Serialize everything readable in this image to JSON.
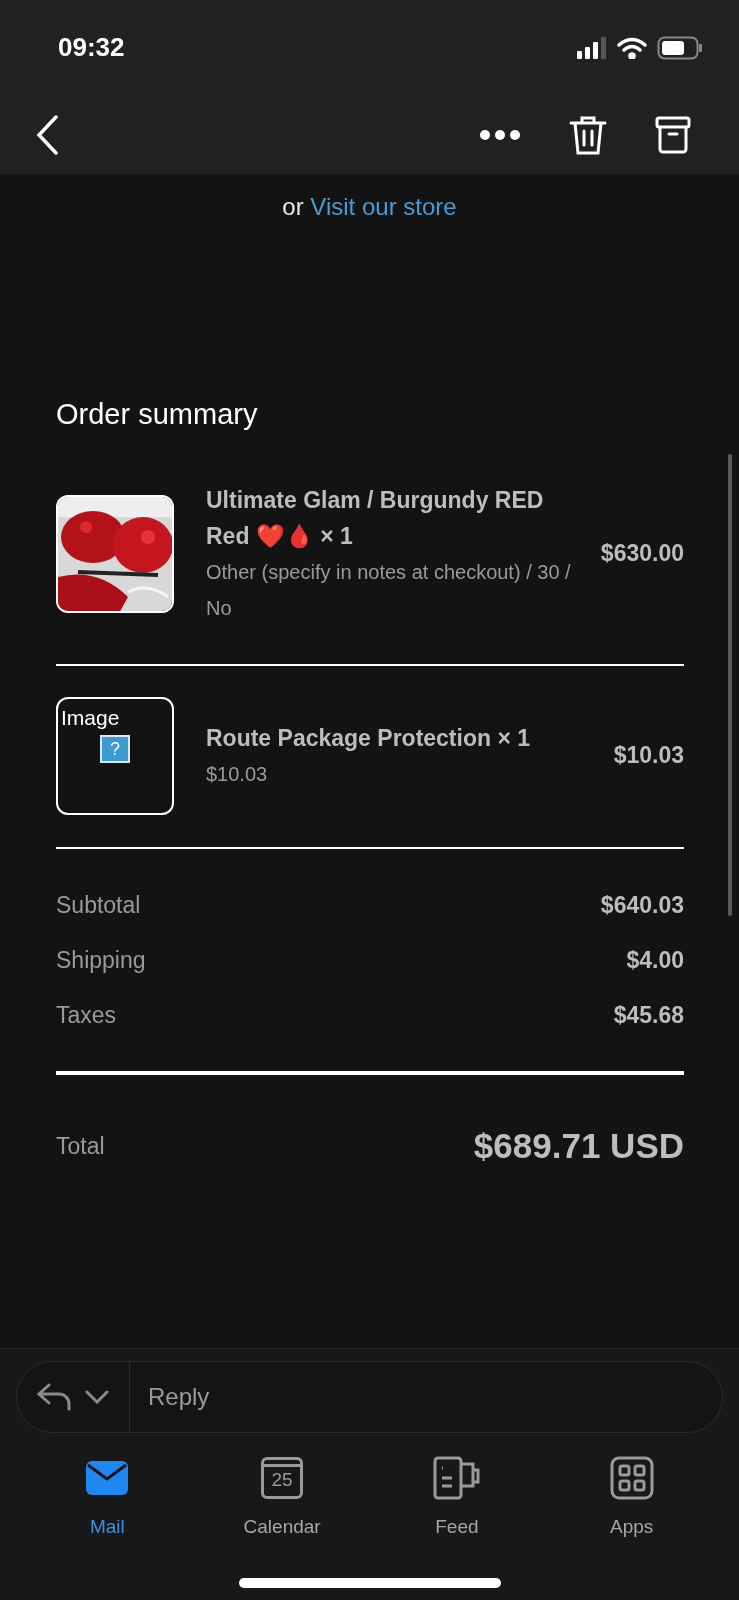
{
  "status_bar": {
    "time": "09:32"
  },
  "header_link": {
    "prefix": "or",
    "link": "Visit our store"
  },
  "order_summary": {
    "title": "Order summary",
    "items": [
      {
        "name": "Ultimate Glam / Burgundy RED Red ❤️🩸 × 1",
        "details": "Other (specify in notes at checkout) / 30 / No",
        "price": "$630.00"
      },
      {
        "kind": "broken",
        "image_alt": "Image",
        "image_icon": "?",
        "name": "Route Package Protection × 1",
        "details": "$10.03",
        "price": "$10.03"
      }
    ],
    "lines": [
      {
        "label": "Subtotal",
        "value": "$640.03"
      },
      {
        "label": "Shipping",
        "value": "$4.00"
      },
      {
        "label": "Taxes",
        "value": "$45.68"
      }
    ],
    "total": {
      "label": "Total",
      "value": "$689.71 USD"
    }
  },
  "reply": {
    "placeholder": "Reply"
  },
  "tabs": [
    {
      "label": "Mail",
      "selected": true
    },
    {
      "label": "Calendar",
      "selected": false,
      "date": "25"
    },
    {
      "label": "Feed",
      "selected": false
    },
    {
      "label": "Apps",
      "selected": false
    }
  ]
}
